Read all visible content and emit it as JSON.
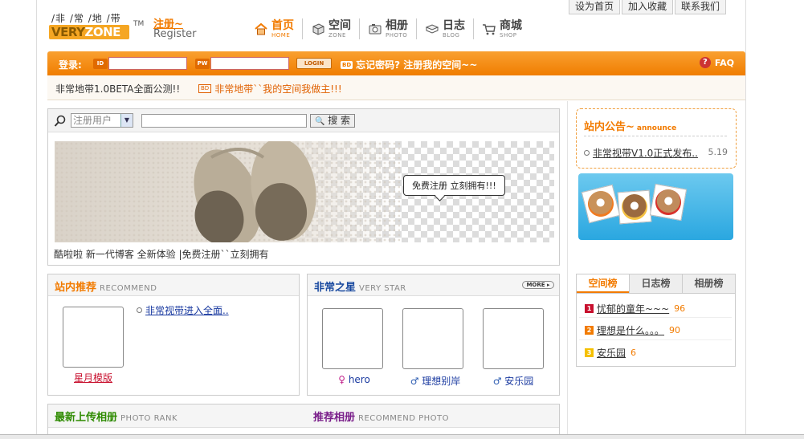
{
  "top_links": [
    "设为首页",
    "加入收藏",
    "联系我们"
  ],
  "logo": {
    "top_text": "/非 /常 /地 /带",
    "main_a": "VERY",
    "main_b": "ZONE",
    "tm": "TM"
  },
  "register": {
    "cn": "注册~",
    "en": "Register"
  },
  "nav": [
    {
      "cn": "首页",
      "en": "HOME",
      "icon": "home-icon",
      "active": true
    },
    {
      "cn": "空间",
      "en": "ZONE",
      "icon": "box-icon"
    },
    {
      "cn": "相册",
      "en": "PHOTO",
      "icon": "camera-icon"
    },
    {
      "cn": "日志",
      "en": "BLOG",
      "icon": "book-icon"
    },
    {
      "cn": "商城",
      "en": "SHOP",
      "icon": "cart-icon"
    }
  ],
  "login": {
    "label": "登录:",
    "id_tag": "ID",
    "pw_tag": "PW",
    "button": "LOGIN",
    "links_tag": "BD",
    "links": "忘记密码? 注册我的空间~~",
    "faq": "FAQ"
  },
  "notice": {
    "left": "非常地带1.0BETA全面公测!!",
    "tag": "BD",
    "right": "非常地带``我的空间我做主!!!"
  },
  "search": {
    "select_value": "注册用户",
    "button": "搜 索"
  },
  "banner": {
    "bubble": "免费注册 立刻拥有!!!",
    "caption": "酷啦啦 新一代博客 全新体验 |免费注册``立刻拥有"
  },
  "recommend": {
    "title": "站内推荐",
    "title_en": "RECOMMEND",
    "thumb_caption": "星月模版",
    "link": "非常视带进入全面.."
  },
  "star": {
    "title": "非常之星",
    "title_en": "VERY STAR",
    "more": "MORE",
    "items": [
      {
        "gender": "♀",
        "name": "hero"
      },
      {
        "gender": "♂",
        "name": "理想别岸"
      },
      {
        "gender": "♂",
        "name": "安乐园"
      }
    ]
  },
  "photo_rank": {
    "title": "最新上传相册",
    "title_en": "PHOTO RANK"
  },
  "recommend_photo": {
    "title": "推荐相册",
    "title_en": "RECOMMEND PHOTO"
  },
  "announce": {
    "title": "站内公告~",
    "title_en": "announce",
    "item": "非常视带V1.0正式发布..",
    "date": "5.19"
  },
  "promo_cards": [
    "lovebear",
    "lovebear",
    "lovebear"
  ],
  "rank": {
    "tabs": [
      "空间榜",
      "日志榜",
      "相册榜"
    ],
    "items": [
      {
        "num": "1",
        "name": "忧郁的童年~~~",
        "count": "96",
        "color": "#c8102e"
      },
      {
        "num": "2",
        "name": "理想是什么。。。",
        "count": "90",
        "color": "#f27b00"
      },
      {
        "num": "3",
        "name": "安乐园",
        "count": "6",
        "color": "#f5c000"
      }
    ]
  },
  "colors": {
    "accent": "#f27b00",
    "orange_bar": "#f78c12",
    "green_title": "#2e8b00",
    "blue_title": "#1a4aa0",
    "purple_title": "#7a1f8a"
  }
}
